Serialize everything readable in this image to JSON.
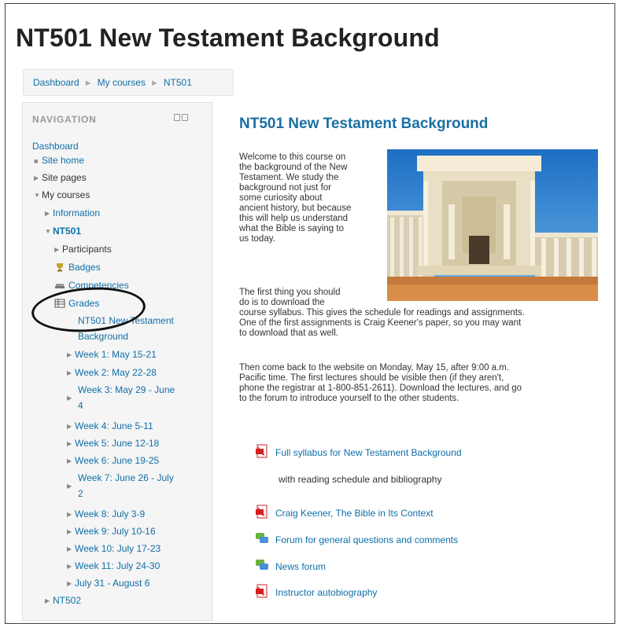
{
  "page": {
    "title": "NT501 New Testament Background"
  },
  "breadcrumb": [
    "Dashboard",
    "My courses",
    "NT501"
  ],
  "navigation": {
    "header": "NAVIGATION",
    "items": [
      {
        "label": "Dashboard"
      },
      {
        "label": "Site home"
      },
      {
        "label": "Site pages"
      },
      {
        "label": "My courses"
      },
      {
        "label": "Information"
      },
      {
        "label": "NT501"
      },
      {
        "label": "Participants"
      },
      {
        "label": "Badges"
      },
      {
        "label": "Competencies"
      },
      {
        "label": "Grades"
      },
      {
        "label": "NT501 New Testament"
      },
      {
        "label": "Background"
      },
      {
        "label": "Week 1: May 15-21"
      },
      {
        "label": "Week 2: May 22-28"
      },
      {
        "label": "Week 3: May 29 - June"
      },
      {
        "label": "4"
      },
      {
        "label": "Week 4: June 5-11"
      },
      {
        "label": "Week 5: June 12-18"
      },
      {
        "label": "Week 6: June 19-25"
      },
      {
        "label": "Week 7: June 26 - July"
      },
      {
        "label": "2"
      },
      {
        "label": "Week 8: July 3-9"
      },
      {
        "label": "Week 9: July 10-16"
      },
      {
        "label": "Week 10: July 17-23"
      },
      {
        "label": "Week 11: July 24-30"
      },
      {
        "label": "July 31 - August 6"
      },
      {
        "label": "NT502"
      }
    ]
  },
  "main": {
    "title": "NT501 New Testament Background",
    "intro_lines": [
      "Welcome to this course on",
      "the background of the New",
      "Testament. We study the",
      "background not just for",
      "some curiosity about",
      "ancient history, but because",
      "this will help us understand",
      "what the Bible is saying to",
      "us today."
    ],
    "para2_lines": [
      "The first thing you should",
      "do is to download the",
      "course syllabus. This gives the schedule for readings and assignments.",
      "One of the first assignments is Craig Keener's paper, so you may want",
      "to download that as well."
    ],
    "para3_lines": [
      "Then come back to the website on Monday, May 15, after 9:00 a.m.",
      "Pacific time. The first lectures should be visible then (if they aren't,",
      "phone the registrar at 1-800-851-2611). Download the lectures, and go",
      "to the forum to introduce yourself to the other students."
    ],
    "resources": [
      {
        "label": "Full syllabus for New Testament Background",
        "icon": "pdf-icon"
      },
      {
        "label": "Craig Keener, The Bible in Its Context",
        "icon": "pdf-icon"
      },
      {
        "label": "Forum for general questions and comments",
        "icon": "forum-icon"
      },
      {
        "label": "News forum",
        "icon": "forum-icon"
      },
      {
        "label": "Instructor autobiography",
        "icon": "pdf-icon"
      }
    ],
    "resource_description": "with reading schedule and bibliography"
  },
  "colors": {
    "link": "#0f6fa8",
    "title": "#1a6fa3",
    "annotation": "#111111"
  }
}
